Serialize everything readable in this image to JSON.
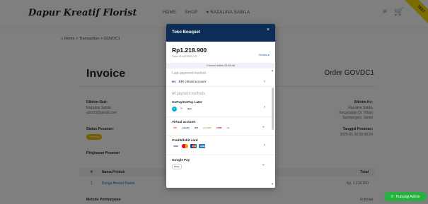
{
  "brand": "Dapur Kreatif Florist",
  "nav": {
    "home": "HOME",
    "shop": "SHOP",
    "user": "♥ RAZALINA SABILA"
  },
  "ribbon": "TEST",
  "breadcrumb": "⌂ Home > Transaction > GOVDC1",
  "invoice_title": "Invoice",
  "order_title": "Order GOVDC1",
  "left_info": {
    "shipping_label": "Dikirim Dari:",
    "shipping_name": "Razalina Sabila",
    "shipping_email": "adi123@gmail.com",
    "status_label": "Status Pesanan:",
    "status_value": "Pending",
    "summary_label": "Ringkasan Pesanan"
  },
  "right_info": {
    "to_label": "Dikirim Ke:",
    "to_name": "Razalina Sabila",
    "to_addr1": "Kecamatan Dr. Hitam",
    "to_addr2": "Sumbergesi, Jambi",
    "date_label": "Tanggal Pesanan:",
    "date_value": "2025-01-10 09:38:24"
  },
  "table": {
    "head_no": "#",
    "head_name": "Nama Produk",
    "head_total": "Total",
    "row_no": "1",
    "row_name": "Bunga Bucket Pastel",
    "row_total": "Rp. 1.218.900"
  },
  "bottom_label": "Metode Pembayaran",
  "bottom_right": "Subtotal",
  "modal": {
    "title": "Toko Bouquet",
    "close": "×",
    "amount": "Rp1.218.900",
    "order_id": "Order ID #GOVDC1 ⧉",
    "details": "Details ▸",
    "countdown": "Choose within 23:59:48",
    "last_method_label": "Last payment method",
    "last_method": "BRI virtual account",
    "bri_logo": "BRI",
    "all_methods_label": "All payment methods",
    "methods": [
      {
        "title": "GoPay/GoPay Later",
        "chevron": "›"
      },
      {
        "title": "Virtual account",
        "chevron": "⌄"
      },
      {
        "title": "Credit/debit card",
        "chevron": "›"
      },
      {
        "title": "Google Pay",
        "chevron": "⌄"
      }
    ],
    "gopay_logos": [
      "G",
      "»",
      "later"
    ],
    "va_logos": [
      "BNI",
      "mandiri",
      "BRI",
      "permata",
      "CIMB",
      "+3"
    ],
    "card_logos": [
      "VISA",
      "MC",
      "JCB",
      "AMEX"
    ],
    "gpay_logo": "GPay"
  },
  "whatsapp": "Hubungi Admin",
  "colors": {
    "modal_header": "#0c2d57",
    "status_pill": "#f2b705",
    "whatsapp": "#25b23d",
    "link": "#2a6bd1"
  }
}
